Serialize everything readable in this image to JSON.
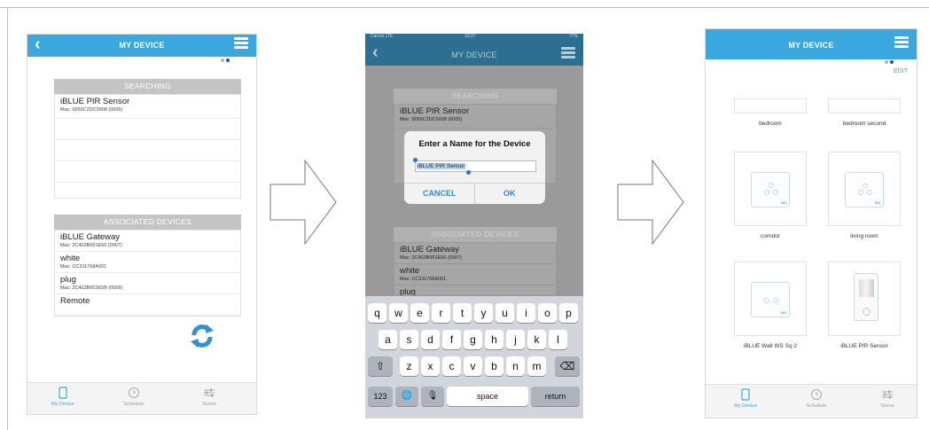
{
  "panel1": {
    "header": {
      "title": "MY DEVICE",
      "back_icon": "chevron-left-icon",
      "menu_icon": "hamburger-icon"
    },
    "searching": {
      "heading": "SEARCHING",
      "items": [
        {
          "name": "iBLUE PIR Sensor",
          "mac": "Mac: 0050C2DC0008 (0005)"
        }
      ]
    },
    "associated": {
      "heading": "ASSOCIATED DEVICES",
      "items": [
        {
          "name": "iBLUE Gateway",
          "mac": "Mac: 2C402B001E56 (0007)"
        },
        {
          "name": "white",
          "mac": "Mac: CC311768A001"
        },
        {
          "name": "plug",
          "mac": "Mac: 2C402B002E5B (0009)"
        },
        {
          "name": "Remote",
          "mac": ""
        }
      ]
    },
    "refresh_icon": "refresh-icon",
    "tabs": [
      {
        "label": "My Device",
        "icon": "phone-icon",
        "active": true
      },
      {
        "label": "Schedule",
        "icon": "clock-icon",
        "active": false
      },
      {
        "label": "Scene",
        "icon": "sliders-icon",
        "active": false
      }
    ]
  },
  "panel2": {
    "status": {
      "carrier": "Carrier LTE",
      "time": "10:27",
      "battery": "77%"
    },
    "header": {
      "title": "MY DEVICE"
    },
    "searching": {
      "heading": "SEARCHING",
      "items": [
        {
          "name": "iBLUE PIR Sensor",
          "mac": "Mac: 0050C2DC0008 (0005)"
        }
      ]
    },
    "dialog": {
      "title": "Enter a Name for the Device",
      "input_value": "iBLUE PIR Sensor",
      "cancel_label": "CANCEL",
      "ok_label": "OK"
    },
    "associated": {
      "heading": "ASSOCIATED DEVICES",
      "items": [
        {
          "name": "iBLUE Gateway",
          "mac": "Mac: 2C402B001E56 (0007)"
        },
        {
          "name": "white",
          "mac": "Mac: CC311768A001"
        },
        {
          "name": "plug",
          "mac": ""
        }
      ]
    },
    "keyboard": {
      "row1": [
        "q",
        "w",
        "e",
        "r",
        "t",
        "y",
        "u",
        "i",
        "o",
        "p"
      ],
      "row2": [
        "a",
        "s",
        "d",
        "f",
        "g",
        "h",
        "j",
        "k",
        "l"
      ],
      "row3": [
        "z",
        "x",
        "c",
        "v",
        "b",
        "n",
        "m"
      ],
      "shift": "⇧",
      "delete": "⌫",
      "numbers": "123",
      "globe": "🌐",
      "mic": "🎙",
      "space": "space",
      "return": "return"
    }
  },
  "panel3": {
    "header": {
      "title": "MY DEVICE"
    },
    "edit_label": "EDIT",
    "rooms": [
      {
        "label": "bedroom",
        "image": "none"
      },
      {
        "label": "bedroom second",
        "image": "none"
      },
      {
        "label": "corridor",
        "image": "switch-plate",
        "badge": "NO"
      },
      {
        "label": "living room",
        "image": "switch-plate",
        "badge": "NO"
      },
      {
        "label": "iBLUE Wall WS Sq 2",
        "image": "switch-plate",
        "badge": "NO"
      },
      {
        "label": "iBLUE PIR Sensor",
        "image": "pir-sensor"
      }
    ],
    "tabs": [
      {
        "label": "My Device",
        "active": true
      },
      {
        "label": "Schedule",
        "active": false
      },
      {
        "label": "Scene",
        "active": false
      }
    ]
  },
  "colors": {
    "accent": "#3aa7de",
    "dialog_button": "#2f88d8"
  }
}
